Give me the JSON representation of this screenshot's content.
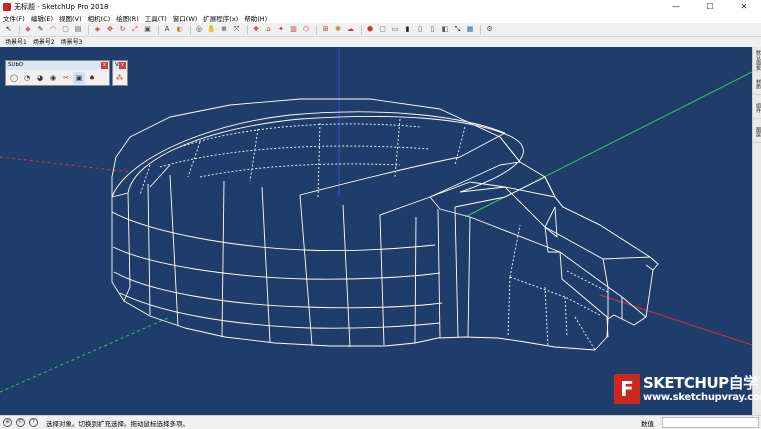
{
  "window": {
    "title": "无标题 - SketchUp Pro 2018",
    "minimize": "—",
    "maximize": "☐",
    "close": "✕"
  },
  "menu": {
    "items": [
      "文件(F)",
      "编辑(E)",
      "视图(V)",
      "相机(C)",
      "绘图(R)",
      "工具(T)",
      "窗口(W)",
      "扩展程序(x)",
      "帮助(H)"
    ]
  },
  "toolbar": {
    "icons": [
      {
        "name": "select-icon",
        "glyph": "↖",
        "color": "#222"
      },
      {
        "name": "eraser-icon",
        "glyph": "◆",
        "color": "#d95a7a"
      },
      {
        "name": "pencil-icon",
        "glyph": "✎",
        "color": "#333"
      },
      {
        "name": "arc-icon",
        "glyph": "◠",
        "color": "#c0392b"
      },
      {
        "name": "shape-icon",
        "glyph": "▢",
        "color": "#7a4fa0"
      },
      {
        "name": "pushpull-icon",
        "glyph": "▤",
        "color": "#555"
      },
      {
        "name": "offset-icon",
        "glyph": "◈",
        "color": "#c0392b"
      },
      {
        "name": "move-icon",
        "glyph": "✥",
        "color": "#c0392b"
      },
      {
        "name": "rotate-icon",
        "glyph": "↻",
        "color": "#c0392b"
      },
      {
        "name": "scale-icon",
        "glyph": "⤢",
        "color": "#c0392b"
      },
      {
        "name": "tape-icon",
        "glyph": "▣",
        "color": "#555"
      },
      {
        "name": "text-icon",
        "glyph": "A",
        "color": "#333"
      },
      {
        "name": "paint-icon",
        "glyph": "◐",
        "color": "#c87a1e"
      },
      {
        "name": "orbit-icon",
        "glyph": "◎",
        "color": "#333"
      },
      {
        "name": "pan-icon",
        "glyph": "✋",
        "color": "#333"
      },
      {
        "name": "zoom-icon",
        "glyph": "⊕",
        "color": "#333"
      },
      {
        "name": "zoom-extents-icon",
        "glyph": "⤧",
        "color": "#333"
      },
      {
        "name": "component-icon",
        "glyph": "❖",
        "color": "#c0392b"
      },
      {
        "name": "warehouse-icon",
        "glyph": "⌂",
        "color": "#c0392b"
      },
      {
        "name": "extension-icon",
        "glyph": "✦",
        "color": "#c0392b"
      },
      {
        "name": "layout-icon",
        "glyph": "▥",
        "color": "#c0392b"
      },
      {
        "name": "style-icon",
        "glyph": "⬡",
        "color": "#c0392b"
      },
      {
        "name": "section-icon",
        "glyph": "⊞",
        "color": "#c0392b"
      },
      {
        "name": "shadow-icon",
        "glyph": "✺",
        "color": "#c87a1e"
      },
      {
        "name": "fog-icon",
        "glyph": "☁",
        "color": "#c0392b"
      },
      {
        "name": "iso-view-icon",
        "glyph": "⬢",
        "color": "#c0392b"
      },
      {
        "name": "top-view-icon",
        "glyph": "▢",
        "color": "#555"
      },
      {
        "name": "front-view-icon",
        "glyph": "▭",
        "color": "#555"
      },
      {
        "name": "right-view-icon",
        "glyph": "▮",
        "color": "#222"
      },
      {
        "name": "back-view-icon",
        "glyph": "▯",
        "color": "#555"
      },
      {
        "name": "left-view-icon",
        "glyph": "▯",
        "color": "#555"
      },
      {
        "name": "xray-icon",
        "glyph": "◧",
        "color": "#555"
      },
      {
        "name": "perspective-icon",
        "glyph": "⤡",
        "color": "#222"
      },
      {
        "name": "grid-icon",
        "glyph": "▦",
        "color": "#2a5ca8"
      },
      {
        "name": "settings-icon",
        "glyph": "⚙",
        "color": "#555"
      }
    ]
  },
  "scenes": {
    "tabs": [
      "场景号1",
      "场景号2",
      "场景号3"
    ]
  },
  "subd_toolbar": {
    "title": "SUbD",
    "close": "x",
    "icons": [
      {
        "name": "subd-cube-icon",
        "glyph": "◯"
      },
      {
        "name": "subd-smooth-icon",
        "glyph": "◔"
      },
      {
        "name": "subd-crease-icon",
        "glyph": "◕"
      },
      {
        "name": "subd-vertex-icon",
        "glyph": "◉"
      },
      {
        "name": "subd-knife-icon",
        "glyph": "✂"
      },
      {
        "name": "subd-active-icon",
        "glyph": "▣"
      },
      {
        "name": "subd-paint-icon",
        "glyph": "♠"
      }
    ]
  },
  "v_toolbar": {
    "title": "V..",
    "close": "x",
    "icons": [
      {
        "name": "vertex-tools-icon",
        "glyph": "⁂"
      }
    ]
  },
  "tray": {
    "tabs": [
      "默认面板",
      "材质",
      "组件",
      "图层"
    ]
  },
  "watermark": {
    "logo": "F",
    "brand": "SKETCHUP自学",
    "url": "www.sketchupvray.com"
  },
  "status": {
    "text": "选择对象。切换到扩充选择。拖动鼠标选择多项。",
    "measure_label": "数值",
    "measure_value": ""
  },
  "colors": {
    "viewport_bg": "#1f3d6b",
    "wire": "#ffffff",
    "axis_green": "#3cc26a",
    "axis_blue": "#3a4ee0",
    "axis_red": "#c23c4a"
  }
}
